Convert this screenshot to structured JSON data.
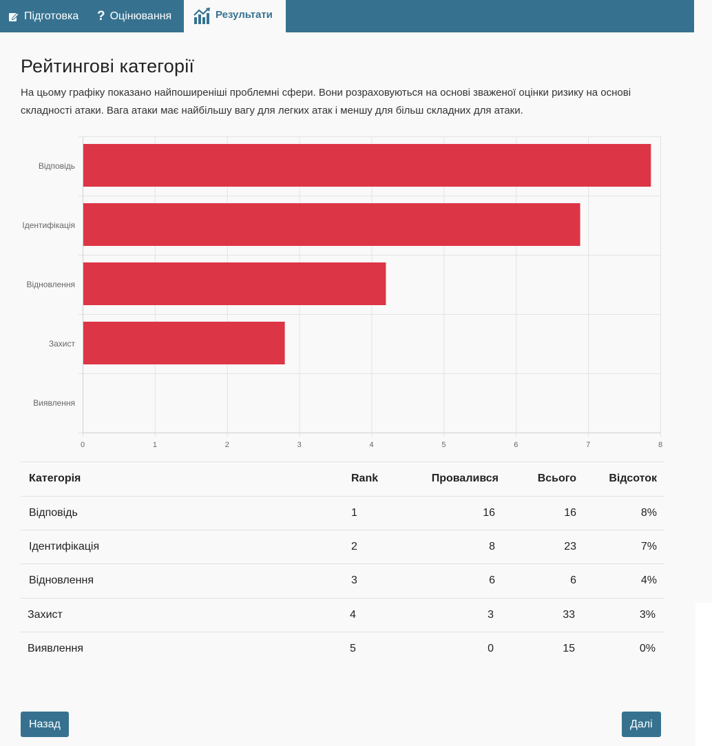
{
  "nav": {
    "tabs": [
      {
        "label": "Підготовка",
        "icon": "edit-icon"
      },
      {
        "label": "Оцінювання",
        "icon": "question-icon"
      },
      {
        "label": "Результати",
        "icon": "chart-icon"
      }
    ]
  },
  "page": {
    "title": "Рейтингові категорії",
    "description": "На цьому графіку показано найпоширеніші проблемні сфери. Вони розраховуються на основі зваженої оцінки ризику на основі складності атаки. Вага атаки має найбільшу вагу для легких атак і меншу для більш складних для атаки."
  },
  "chart_data": {
    "type": "bar",
    "orientation": "horizontal",
    "categories": [
      "Відповідь",
      "Ідентифікація",
      "Відновлення",
      "Захист",
      "Виявлення"
    ],
    "values": [
      7.86,
      6.88,
      4.19,
      2.79,
      0
    ],
    "xlim": [
      0,
      8
    ],
    "xticks": [
      "0",
      "1",
      "2",
      "3",
      "4",
      "5",
      "6",
      "7",
      "8"
    ],
    "bar_color": "#dc3545",
    "grid": true
  },
  "table": {
    "headers": {
      "category": "Категорія",
      "rank": "Rank",
      "failed": "Провалився",
      "total": "Всього",
      "percent": "Відсоток"
    },
    "rows": [
      {
        "category": "Відповідь",
        "rank": "1",
        "failed": "16",
        "total": "16",
        "percent": "8%"
      },
      {
        "category": "Ідентифікація",
        "rank": "2",
        "failed": "8",
        "total": "23",
        "percent": "7%"
      },
      {
        "category": "Відновлення",
        "rank": "3",
        "failed": "6",
        "total": "6",
        "percent": "4%"
      },
      {
        "category": "Захист",
        "rank": "4",
        "failed": "3",
        "total": "33",
        "percent": "3%"
      },
      {
        "category": "Виявлення",
        "rank": "5",
        "failed": "0",
        "total": "15",
        "percent": "0%"
      }
    ]
  },
  "buttons": {
    "back": "Назад",
    "next": "Далі"
  },
  "colors": {
    "nav": "#367290",
    "bar": "#dc3545",
    "button": "#367290"
  }
}
